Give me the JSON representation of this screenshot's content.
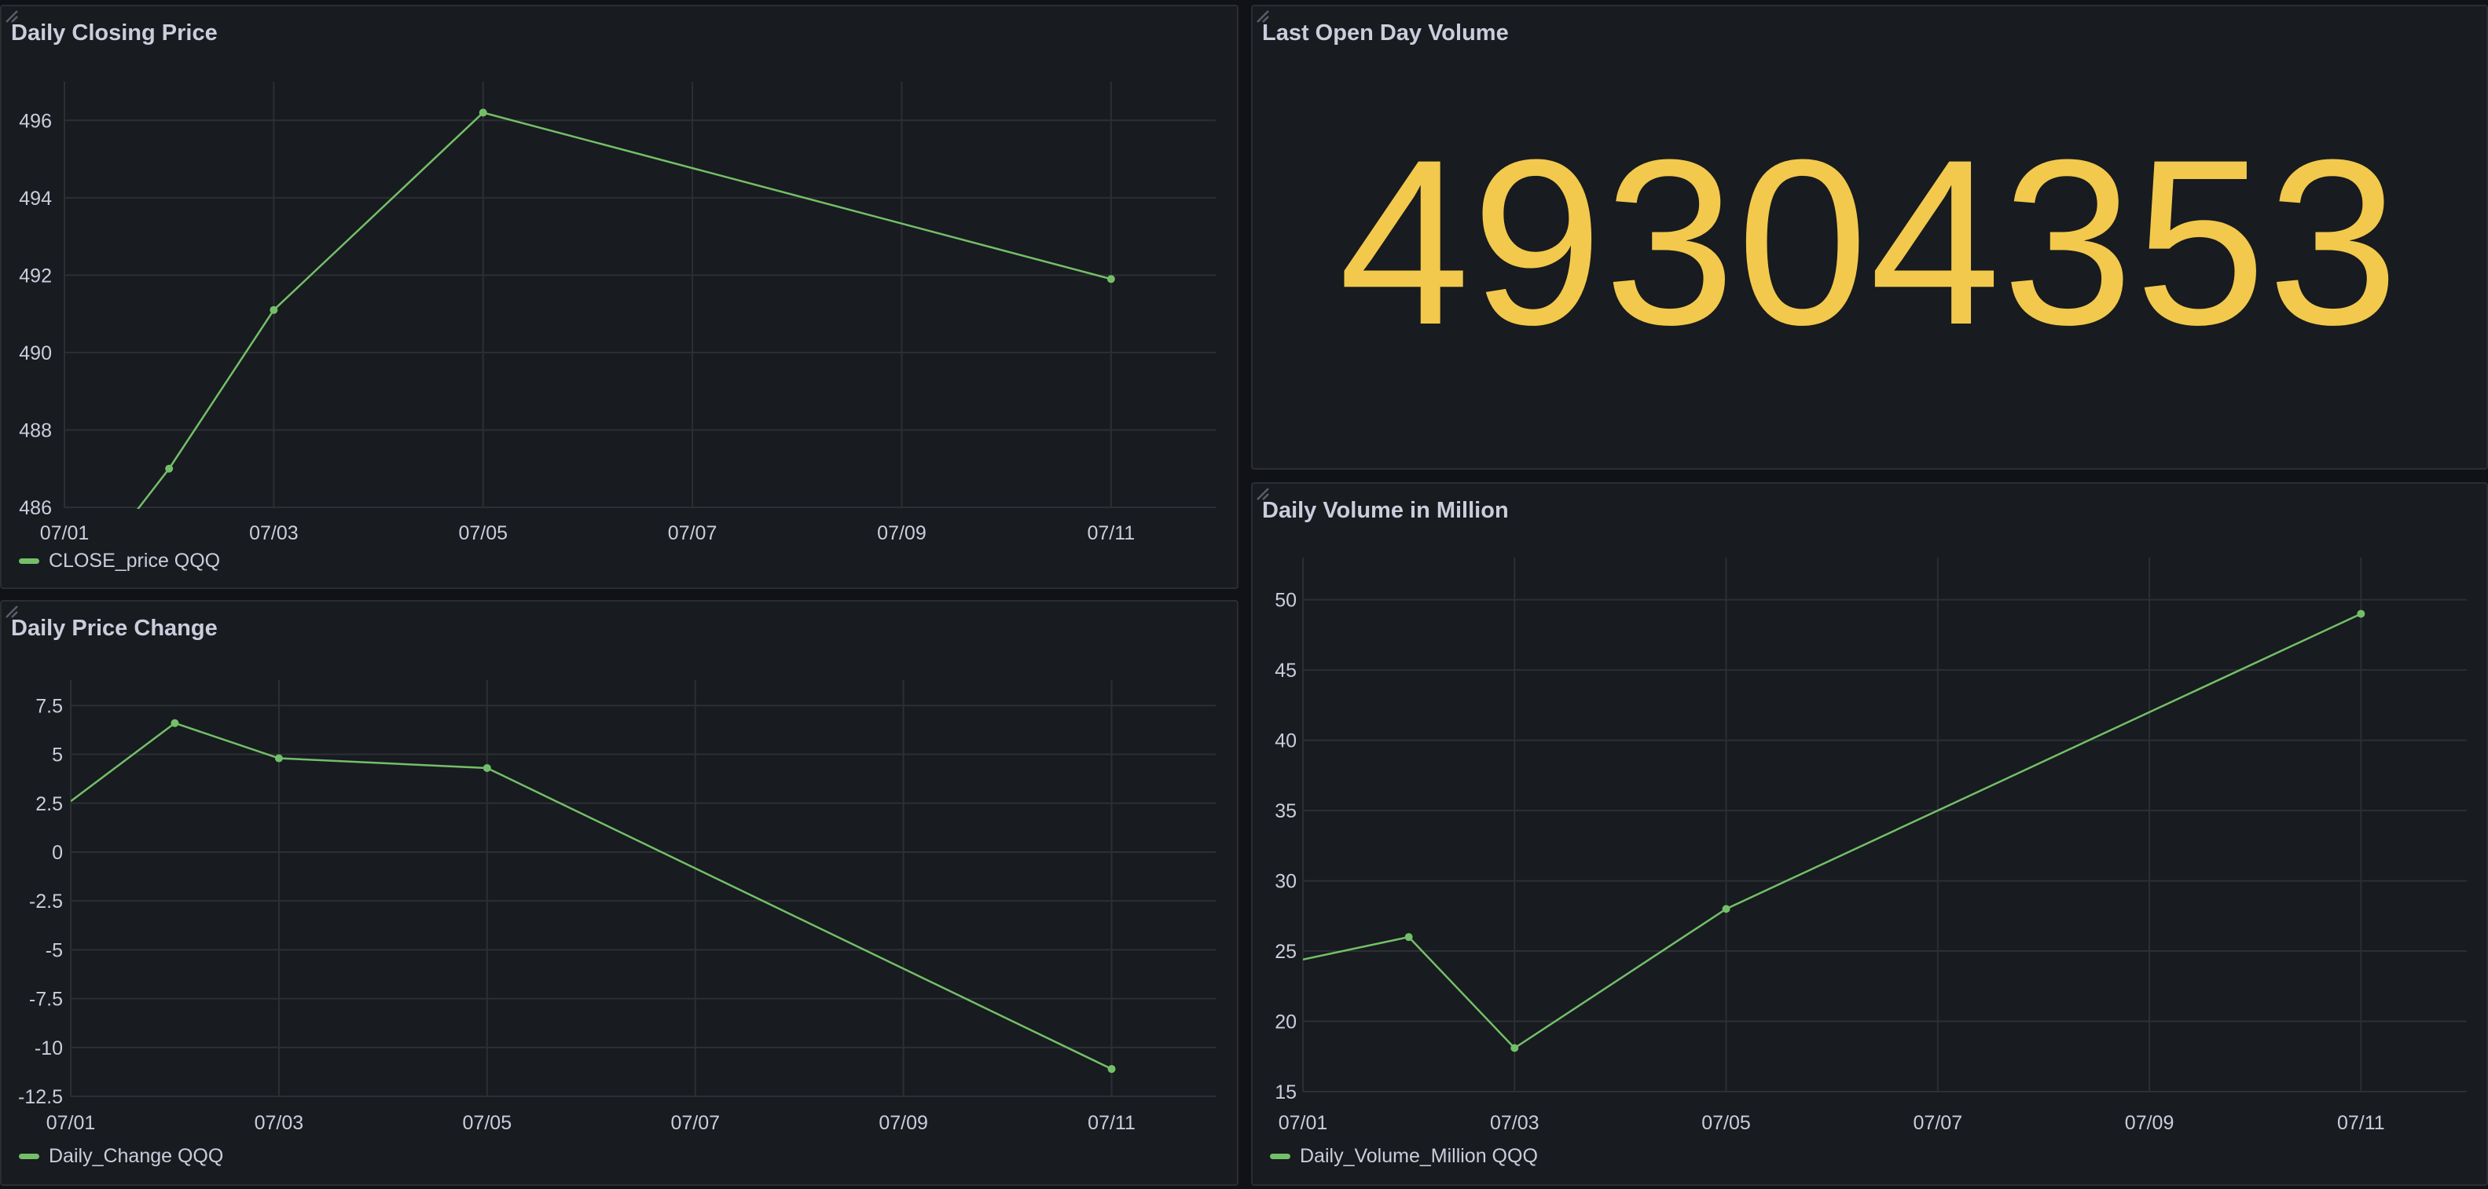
{
  "theme": {
    "series_color": "#73bf69",
    "stat_color": "#f2c94c",
    "grid_color": "#2c2f34"
  },
  "panels": {
    "closing": {
      "title": "Daily Closing Price",
      "legend": "CLOSE_price QQQ"
    },
    "volume_stat": {
      "title": "Last Open Day Volume",
      "value": "49304353"
    },
    "change": {
      "title": "Daily Price Change",
      "legend": "Daily_Change QQQ"
    },
    "volume_million": {
      "title": "Daily Volume in Million",
      "legend": "Daily_Volume_Million QQQ"
    }
  },
  "chart_data": [
    {
      "id": "closing",
      "type": "line",
      "title": "Daily Closing Price",
      "x_ticks": [
        "07/01",
        "07/03",
        "07/05",
        "07/07",
        "07/09",
        "07/11"
      ],
      "y_ticks": [
        "486",
        "488",
        "490",
        "492",
        "494",
        "496"
      ],
      "xlim": [
        "07/01",
        "07/12"
      ],
      "ylim": [
        486,
        497
      ],
      "grid": true,
      "legend_position": "bottom-left",
      "series": [
        {
          "name": "CLOSE_price QQQ",
          "points": [
            {
              "x": "07/01",
              "y": 483.5
            },
            {
              "x": "07/02",
              "y": 487.0
            },
            {
              "x": "07/03",
              "y": 491.1
            },
            {
              "x": "07/05",
              "y": 496.2
            },
            {
              "x": "07/11",
              "y": 491.9
            }
          ]
        }
      ]
    },
    {
      "id": "change",
      "type": "line",
      "title": "Daily Price Change",
      "x_ticks": [
        "07/01",
        "07/03",
        "07/05",
        "07/07",
        "07/09",
        "07/11"
      ],
      "y_ticks": [
        "7.5",
        "5",
        "2.5",
        "0",
        "-2.5",
        "-5",
        "-7.5",
        "-10",
        "-12.5"
      ],
      "xlim": [
        "07/01",
        "07/12"
      ],
      "ylim": [
        -12.5,
        8.8
      ],
      "grid": true,
      "legend_position": "bottom-left",
      "series": [
        {
          "name": "Daily_Change QQQ",
          "points": [
            {
              "x": "07/01",
              "y": 2.6
            },
            {
              "x": "07/02",
              "y": 6.6
            },
            {
              "x": "07/03",
              "y": 4.8
            },
            {
              "x": "07/05",
              "y": 4.3
            },
            {
              "x": "07/11",
              "y": -11.1
            }
          ]
        }
      ]
    },
    {
      "id": "volume_million",
      "type": "line",
      "title": "Daily Volume in Million",
      "x_ticks": [
        "07/01",
        "07/03",
        "07/05",
        "07/07",
        "07/09",
        "07/11"
      ],
      "y_ticks": [
        "15",
        "20",
        "25",
        "30",
        "35",
        "40",
        "45",
        "50"
      ],
      "xlim": [
        "07/01",
        "07/12"
      ],
      "ylim": [
        15,
        53
      ],
      "grid": true,
      "legend_position": "bottom-left",
      "series": [
        {
          "name": "Daily_Volume_Million QQQ",
          "points": [
            {
              "x": "07/01",
              "y": 24.4
            },
            {
              "x": "07/02",
              "y": 26.0
            },
            {
              "x": "07/03",
              "y": 18.1
            },
            {
              "x": "07/05",
              "y": 28.0
            },
            {
              "x": "07/11",
              "y": 49.0
            }
          ]
        }
      ]
    }
  ]
}
